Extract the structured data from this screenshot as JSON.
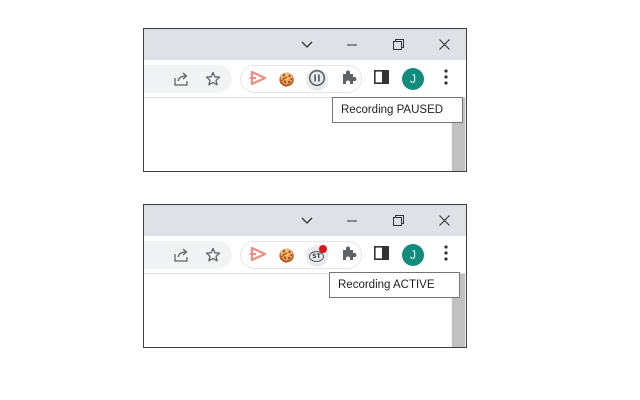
{
  "screenshots": [
    {
      "id": "paused",
      "tooltip": "Recording PAUSED",
      "recorder_state": "paused",
      "avatar_letter": "J"
    },
    {
      "id": "active",
      "tooltip": "Recording ACTIVE",
      "recorder_state": "active",
      "recorder_badge_text": "ST",
      "avatar_letter": "J"
    }
  ],
  "colors": {
    "titlebar": "#dee1e6",
    "avatar": "#128c7e",
    "record_dot": "#e0141a",
    "play_icon": "#f28b82"
  },
  "icons": [
    "chevron-down-icon",
    "minimize-icon",
    "restore-icon",
    "close-icon",
    "share-icon",
    "star-icon",
    "play-extension-icon",
    "cookie-icon",
    "pause-icon",
    "recording-icon",
    "puzzle-icon",
    "side-panel-icon",
    "kebab-menu-icon"
  ]
}
